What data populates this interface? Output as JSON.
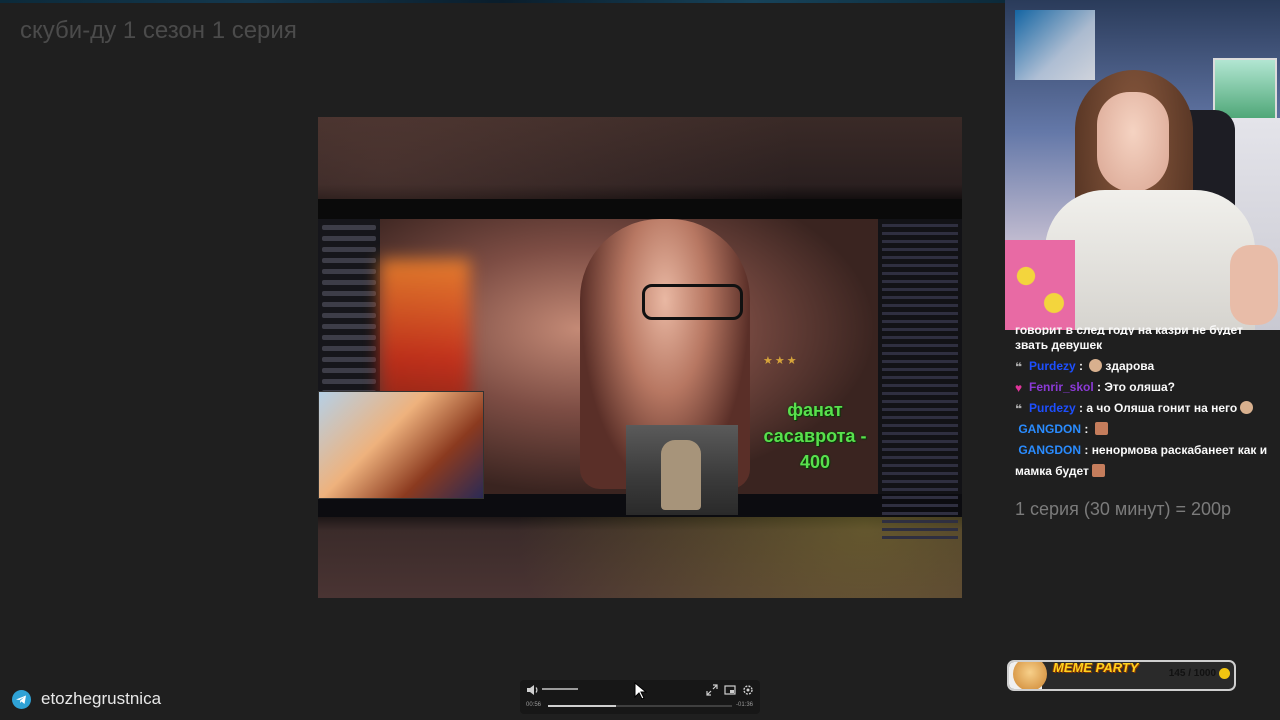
{
  "page": {
    "title": "скуби-ду 1 сезон 1 серия"
  },
  "video_overlay": {
    "green_text": "фанат\nсасаврота -\n400"
  },
  "player": {
    "current_time": "00:56",
    "end_time": "-01:36",
    "progress": 0.37,
    "volume": 1.0,
    "icons": [
      "volume-icon",
      "fullscreen-icon",
      "picture-in-picture-icon",
      "settings-icon"
    ]
  },
  "telegram": {
    "handle": "etozhegrustnica",
    "icon": "telegram-icon",
    "color": "#2fa2d6"
  },
  "chat": {
    "cut_text": "говорит в след году на казри не будет",
    "messages": [
      {
        "user": "",
        "text": "звать девушек"
      },
      {
        "user": "Purdezy",
        "text": "здарова"
      },
      {
        "user": "Fenrir_skol",
        "text": "Это оляша?"
      },
      {
        "user": "Purdezy",
        "text": "а чо Оляша гонит на него"
      },
      {
        "user": "GANGDON",
        "text": ""
      },
      {
        "user": "GANGDON",
        "text": "ненормова раскабанеет как и мамка будет"
      }
    ]
  },
  "price_text": "1 серия (30 минут) = 200р",
  "meme_party": {
    "title": "MEME PARTY",
    "count": "145 / 1000",
    "progress": 0.145
  }
}
